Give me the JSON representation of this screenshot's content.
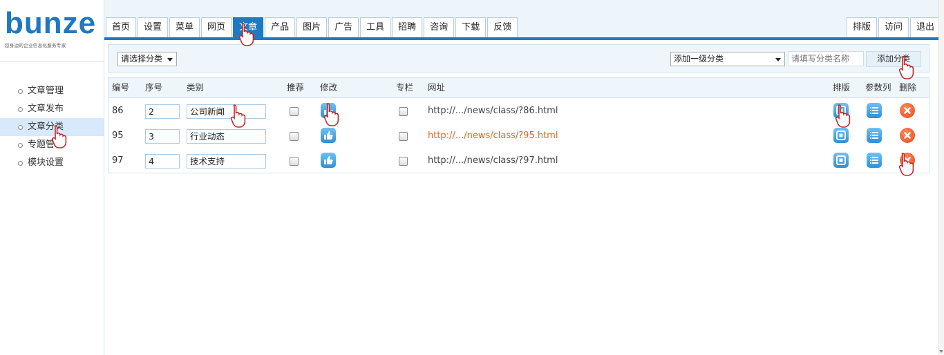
{
  "brand": {
    "logo": "bunze",
    "slogan": "您身边的企业信息化服务专家"
  },
  "sidebar": {
    "items": [
      {
        "label": "文章管理",
        "active": false
      },
      {
        "label": "文章发布",
        "active": false
      },
      {
        "label": "文章分类",
        "active": true
      },
      {
        "label": "专题管理",
        "active": false
      },
      {
        "label": "模块设置",
        "active": false
      }
    ]
  },
  "topnav": {
    "tabs": [
      {
        "label": "首页",
        "active": false
      },
      {
        "label": "设置",
        "active": false
      },
      {
        "label": "菜单",
        "active": false
      },
      {
        "label": "网页",
        "active": false
      },
      {
        "label": "文章",
        "active": true
      },
      {
        "label": "产品",
        "active": false
      },
      {
        "label": "图片",
        "active": false
      },
      {
        "label": "广告",
        "active": false
      },
      {
        "label": "工具",
        "active": false
      },
      {
        "label": "招聘",
        "active": false
      },
      {
        "label": "咨询",
        "active": false
      },
      {
        "label": "下载",
        "active": false
      },
      {
        "label": "反馈",
        "active": false
      }
    ],
    "right_tabs": [
      {
        "label": "排版"
      },
      {
        "label": "访问"
      },
      {
        "label": "退出"
      }
    ]
  },
  "toolbar": {
    "category_filter": "请选择分类",
    "level_select": "添加一级分类",
    "name_placeholder": "请填写分类名称",
    "add_button": "添加分类"
  },
  "table": {
    "headers": {
      "id": "编号",
      "order": "序号",
      "category": "类别",
      "recommend": "推荐",
      "edit": "修改",
      "column": "专栏",
      "url": "网址",
      "sort": "排版",
      "params": "参数列",
      "delete": "删除"
    },
    "rows": [
      {
        "id": "86",
        "order": "2",
        "name": "公司新闻",
        "url": "http://.../news/class/?86.html",
        "highlight": false
      },
      {
        "id": "95",
        "order": "3",
        "name": "行业动态",
        "url": "http://.../news/class/?95.html",
        "highlight": true
      },
      {
        "id": "97",
        "order": "4",
        "name": "技术支持",
        "url": "http://.../news/class/?97.html",
        "highlight": false
      }
    ]
  },
  "colors": {
    "accent": "#1f7ac2",
    "link_highlight": "#e2642a",
    "delete": "#e34b1d"
  }
}
